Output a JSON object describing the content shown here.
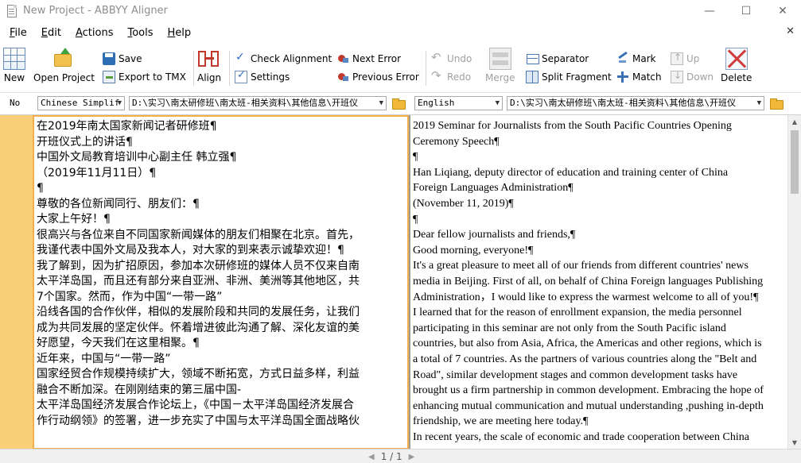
{
  "window": {
    "title": "New Project - ABBYY Aligner",
    "minimize": "—",
    "maximize": "☐",
    "close": "✕"
  },
  "menu": {
    "items": [
      {
        "label": "File",
        "accel": "F",
        "rest": "ile"
      },
      {
        "label": "Edit",
        "accel": "E",
        "rest": "dit"
      },
      {
        "label": "Actions",
        "accel": "A",
        "rest": "ctions"
      },
      {
        "label": "Tools",
        "accel": "T",
        "rest": "ools"
      },
      {
        "label": "Help",
        "accel": "H",
        "rest": "elp"
      }
    ],
    "close_glyph": "✕"
  },
  "toolbar": {
    "new": "New",
    "open_project": "Open Project",
    "save": "Save",
    "export_tmx": "Export to TMX",
    "align": "Align",
    "check_alignment": "Check Alignment",
    "settings": "Settings",
    "next_error": "Next Error",
    "previous_error": "Previous Error",
    "undo": "Undo",
    "redo": "Redo",
    "merge": "Merge",
    "separator": "Separator",
    "split_fragment": "Split Fragment",
    "mark": "Mark",
    "match": "Match",
    "up": "Up",
    "down": "Down",
    "delete": "Delete"
  },
  "selectors": {
    "no_label": "No",
    "left_language": "Chinese Simplif",
    "left_path": "D:\\实习\\南太研修班\\南太班-相关资料\\其他信息\\开班仪",
    "right_language": "English",
    "right_path": "D:\\实习\\南太研修班\\南太班-相关资料\\其他信息\\开班仪"
  },
  "left_lines": [
    "在2019年南太国家新闻记者研修班¶",
    "开班仪式上的讲话¶",
    "中国外文局教育培训中心副主任 韩立强¶",
    "（2019年11月11日）¶",
    "¶",
    "尊敬的各位新闻同行、朋友们：¶",
    "大家上午好！¶",
    "很高兴与各位来自不同国家新闻媒体的朋友们相聚在北京。首先，",
    "我谨代表中国外文局及我本人，对大家的到来表示诚挚欢迎！¶",
    "我了解到，因为扩招原因，参加本次研修班的媒体人员不仅来自南",
    "太平洋岛国，而且还有部分来自亚洲、非洲、美洲等其他地区，共",
    "7个国家。然而，作为中国“一带一路”",
    "沿线各国的合作伙伴，相似的发展阶段和共同的发展任务，让我们",
    "成为共同发展的坚定伙伴。怀着增进彼此沟通了解、深化友谊的美",
    "好愿望，今天我们在这里相聚。¶",
    "近年来，中国与“一带一路”",
    "国家经贸合作规模持续扩大，领域不断拓宽，方式日益多样，利益",
    "融合不断加深。在刚刚结束的第三届中国-",
    "太平洋岛国经济发展合作论坛上，《中国－太平洋岛国经济发展合",
    "作行动纲领》的签署，进一步充实了中国与太平洋岛国全面战略伙"
  ],
  "right_lines": [
    "2019 Seminar for Journalists from the South Pacific Countries Opening",
    "Ceremony Speech¶",
    "¶",
    "Han Liqiang, deputy director of education and training center of China",
    "Foreign Languages Administration¶",
    "(November 11, 2019)¶",
    "¶",
    "Dear fellow journalists and friends,¶",
    "Good morning, everyone!¶",
    "It's a great pleasure to meet all of our friends from different countries' news",
    "media in Beijing. First of all, on behalf of China Foreign languages Publishing",
    "Administration，I would like to express the warmest welcome to all of you!¶",
    "I learned that for the reason of enrollment expansion, the media personnel",
    "participating in this seminar are not only from the South Pacific island",
    "countries, but also from Asia, Africa, the Americas and other regions, which is",
    "a total of 7 countries. As the partners of various countries along the \"Belt and",
    "Road\", similar development stages and common development tasks have",
    "brought us a firm partnership in common development. Embracing the hope of",
    "enhancing mutual communication and mutual understanding ,pushing in-depth",
    "friendship, we are meeting here today.¶",
    "In recent years, the scale of economic and trade cooperation between China"
  ],
  "status": {
    "page": "1 / 1",
    "prev": "◀",
    "next": "▶"
  },
  "colors": {
    "gutter": "#f9cf7a",
    "left_pane_border": "#f3b04a"
  }
}
